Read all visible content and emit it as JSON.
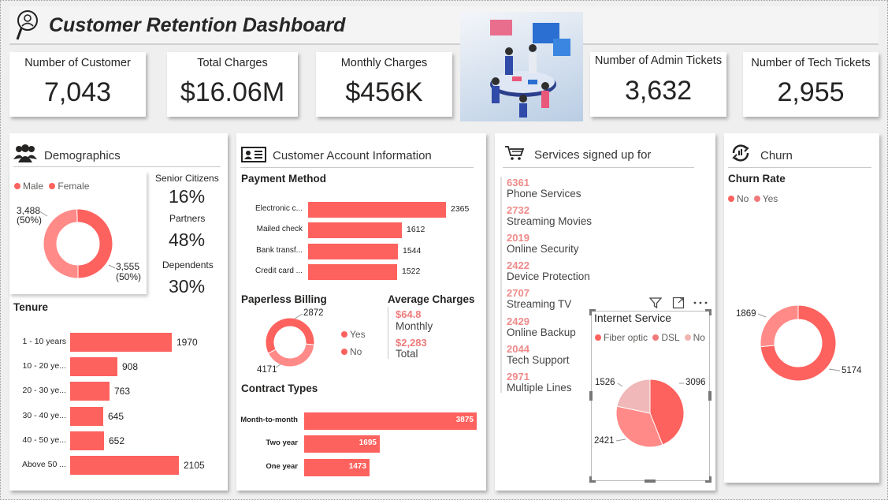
{
  "header": {
    "title": "Customer Retention Dashboard"
  },
  "kpis": [
    {
      "label": "Number of Customer",
      "value": "7,043"
    },
    {
      "label": "Total Charges",
      "value": "$16.06M"
    },
    {
      "label": "Monthly Charges",
      "value": "$456K"
    },
    {
      "label": "Number of Admin Tickets",
      "value": "3,632"
    },
    {
      "label": "Number of Tech Tickets",
      "value": "2,955"
    }
  ],
  "demographics": {
    "title": "Demographics",
    "gender_legend": [
      "Male",
      "Female"
    ],
    "gender_labels": {
      "male": "3,488",
      "male_pct": "(50%)",
      "female": "3,555",
      "female_pct": "(50%)"
    },
    "senior_label": "Senior Citizens",
    "senior_value": "16%",
    "partners_label": "Partners",
    "partners_value": "48%",
    "dependents_label": "Dependents",
    "dependents_value": "30%",
    "tenure_title": "Tenure"
  },
  "account": {
    "title": "Customer Account Information",
    "payment_title": "Payment Method",
    "paperless_title": "Paperless Billing",
    "paperless_legend": [
      "Yes",
      "No"
    ],
    "avg_title": "Average Charges",
    "avg_monthly_value": "$64.8",
    "avg_monthly_label": "Monthly",
    "avg_total_value": "$2,283",
    "avg_total_label": "Total",
    "contract_title": "Contract Types"
  },
  "services": {
    "title": "Services signed up for",
    "items": [
      {
        "count": "6361",
        "name": "Phone Services"
      },
      {
        "count": "2732",
        "name": "Streaming Movies"
      },
      {
        "count": "2019",
        "name": "Online Security"
      },
      {
        "count": "2422",
        "name": "Device Protection"
      },
      {
        "count": "2707",
        "name": "Streaming TV"
      },
      {
        "count": "2429",
        "name": "Online Backup"
      },
      {
        "count": "2044",
        "name": "Tech Support"
      },
      {
        "count": "2971",
        "name": "Multiple Lines"
      }
    ],
    "internet_title": "Internet Service",
    "internet_legend": [
      "Fiber optic",
      "DSL",
      "No"
    ]
  },
  "churn": {
    "title": "Churn",
    "rate_title": "Churn Rate",
    "legend": [
      "No",
      "Yes"
    ]
  },
  "colors": {
    "accent": "#fd625e",
    "accent_light": "#ff8a88",
    "accent_pale": "#f0b8b8",
    "header_text": "#262626"
  },
  "chart_data": [
    {
      "type": "pie",
      "name": "gender",
      "categories": [
        "Male",
        "Female"
      ],
      "values": [
        3488,
        3555
      ],
      "donut": true
    },
    {
      "type": "bar",
      "name": "tenure",
      "orientation": "horizontal",
      "title": "Tenure",
      "categories": [
        "1 - 10 years",
        "10 - 20 ye...",
        "20 - 30 ye...",
        "30 - 40 ye...",
        "40 - 50 ye...",
        "Above 50 ..."
      ],
      "values": [
        1970,
        908,
        763,
        645,
        652,
        2105
      ]
    },
    {
      "type": "bar",
      "name": "payment",
      "orientation": "horizontal",
      "title": "Payment Method",
      "categories": [
        "Electronic c...",
        "Mailed check",
        "Bank transf...",
        "Credit card ..."
      ],
      "values": [
        2365,
        1612,
        1544,
        1522
      ]
    },
    {
      "type": "pie",
      "name": "paperless",
      "title": "Paperless Billing",
      "categories": [
        "Yes",
        "No"
      ],
      "values": [
        4171,
        2872
      ],
      "donut": true
    },
    {
      "type": "bar",
      "name": "contract",
      "orientation": "horizontal",
      "title": "Contract Types",
      "categories": [
        "Month-to-month",
        "Two year",
        "One year"
      ],
      "values": [
        3875,
        1695,
        1473
      ]
    },
    {
      "type": "pie",
      "name": "internet",
      "title": "Internet Service",
      "categories": [
        "Fiber optic",
        "DSL",
        "No"
      ],
      "values": [
        3096,
        2421,
        1526
      ]
    },
    {
      "type": "pie",
      "name": "churn",
      "title": "Churn Rate",
      "categories": [
        "No",
        "Yes"
      ],
      "values": [
        5174,
        1869
      ],
      "donut": true
    }
  ]
}
